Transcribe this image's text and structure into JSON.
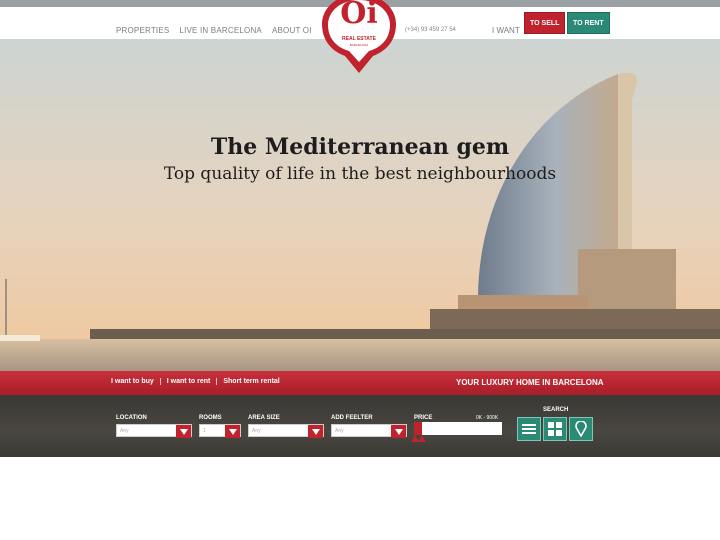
{
  "nav": {
    "properties": "PROPERTIES",
    "live_in_barcelona": "LIVE IN BARCELONA",
    "about": "ABOUT OI"
  },
  "logo": {
    "mark": "Oi",
    "line1": "REAL ESTATE",
    "line2": "BARCELONA"
  },
  "phone": "(+34) 93 459 27 54",
  "i_want": "I WANT",
  "buttons": {
    "to_sell": "TO SELL",
    "to_rent": "TO RENT"
  },
  "hero": {
    "title": "The Mediterranean gem",
    "subtitle": "Top quality of life in the best neighbourhoods"
  },
  "tabs": [
    "I want to buy",
    "I want to rent",
    "Short term rental"
  ],
  "tagline": "YOUR LUXURY HOME IN BARCELONA",
  "search": {
    "location": {
      "label": "LOCATION",
      "value": "Any"
    },
    "rooms": {
      "label": "ROOMS",
      "value": "1"
    },
    "area": {
      "label": "AREA SIZE",
      "value": "Any"
    },
    "feelter": {
      "label": "ADD FEELTER",
      "value": "Any"
    },
    "price": {
      "label": "PRICE",
      "range": "0K - 900K"
    },
    "search_label": "SEARCH",
    "icons": [
      "list-icon",
      "grid-icon",
      "map-pin-icon"
    ]
  },
  "colors": {
    "accent_red": "#c0232e",
    "accent_green": "#2a8a75"
  }
}
